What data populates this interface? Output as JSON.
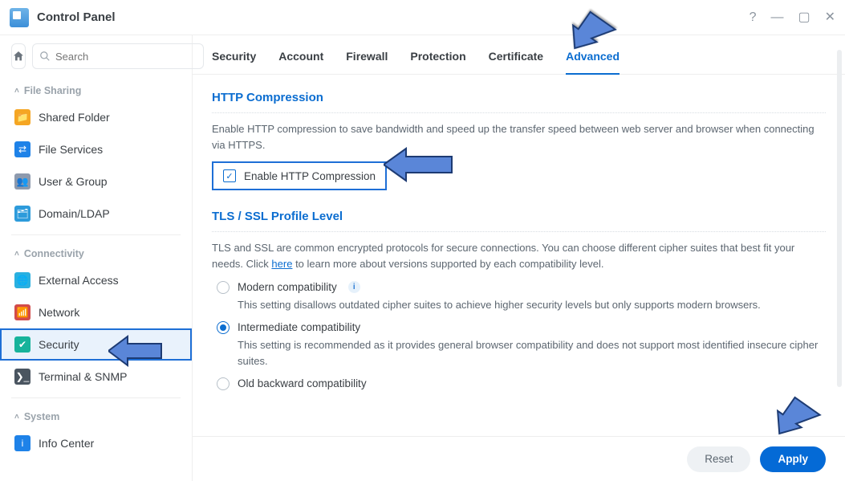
{
  "window": {
    "title": "Control Panel"
  },
  "search": {
    "placeholder": "Search"
  },
  "groups": {
    "file_sharing": "File Sharing",
    "connectivity": "Connectivity",
    "system": "System"
  },
  "sidebar": {
    "items": [
      {
        "label": "Shared Folder"
      },
      {
        "label": "File Services"
      },
      {
        "label": "User & Group"
      },
      {
        "label": "Domain/LDAP"
      },
      {
        "label": "External Access"
      },
      {
        "label": "Network"
      },
      {
        "label": "Security"
      },
      {
        "label": "Terminal & SNMP"
      },
      {
        "label": "Info Center"
      }
    ]
  },
  "tabs": {
    "security": "Security",
    "account": "Account",
    "firewall": "Firewall",
    "protection": "Protection",
    "certificate": "Certificate",
    "advanced": "Advanced"
  },
  "http": {
    "title": "HTTP Compression",
    "desc": "Enable HTTP compression to save bandwidth and speed up the transfer speed between web server and browser when connecting via HTTPS.",
    "checkbox_label": "Enable HTTP Compression",
    "checked": true
  },
  "tls": {
    "title": "TLS / SSL Profile Level",
    "desc_a": "TLS and SSL are common encrypted protocols for secure connections. You can choose different cipher suites that best fit your needs. Click ",
    "here": "here",
    "desc_b": " to learn more about versions supported by each compatibility level.",
    "options": {
      "modern": {
        "label": "Modern compatibility",
        "desc": "This setting disallows outdated cipher suites to achieve higher security levels but only supports modern browsers."
      },
      "intermediate": {
        "label": "Intermediate compatibility",
        "desc": "This setting is recommended as it provides general browser compatibility and does not support most identified insecure cipher suites."
      },
      "old": {
        "label": "Old backward compatibility"
      }
    },
    "selected": "intermediate"
  },
  "footer": {
    "reset": "Reset",
    "apply": "Apply"
  }
}
